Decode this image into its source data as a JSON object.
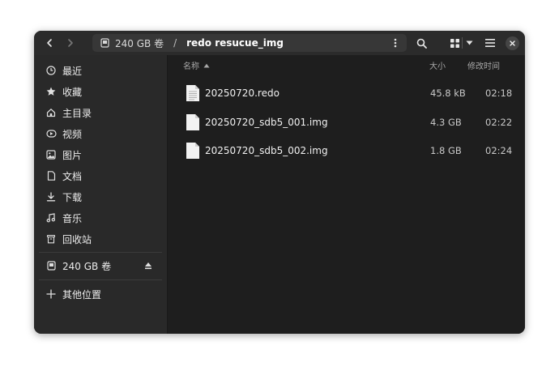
{
  "header": {
    "path_segments": [
      "240 GB 卷",
      "redo resucue_img"
    ],
    "path_separator": "/"
  },
  "sidebar": {
    "places": [
      {
        "label": "最近",
        "icon": "clock-icon"
      },
      {
        "label": "收藏",
        "icon": "star-icon"
      },
      {
        "label": "主目录",
        "icon": "home-icon"
      },
      {
        "label": "视频",
        "icon": "video-icon"
      },
      {
        "label": "图片",
        "icon": "image-icon"
      },
      {
        "label": "文档",
        "icon": "document-icon"
      },
      {
        "label": "下载",
        "icon": "download-icon"
      },
      {
        "label": "音乐",
        "icon": "music-icon"
      },
      {
        "label": "回收站",
        "icon": "trash-icon"
      }
    ],
    "devices": [
      {
        "label": "240 GB 卷",
        "icon": "drive-icon"
      }
    ],
    "other": {
      "label": "其他位置",
      "icon": "plus-icon"
    }
  },
  "columns": {
    "name": "名称",
    "size": "大小",
    "modified": "修改时间"
  },
  "files": [
    {
      "name": "20250720.redo",
      "size": "45.8 kB",
      "modified": "02:18",
      "icon": "text-file-icon"
    },
    {
      "name": "20250720_sdb5_001.img",
      "size": "4.3 GB",
      "modified": "02:22",
      "icon": "file-icon"
    },
    {
      "name": "20250720_sdb5_002.img",
      "size": "1.8 GB",
      "modified": "02:24",
      "icon": "file-icon"
    }
  ]
}
